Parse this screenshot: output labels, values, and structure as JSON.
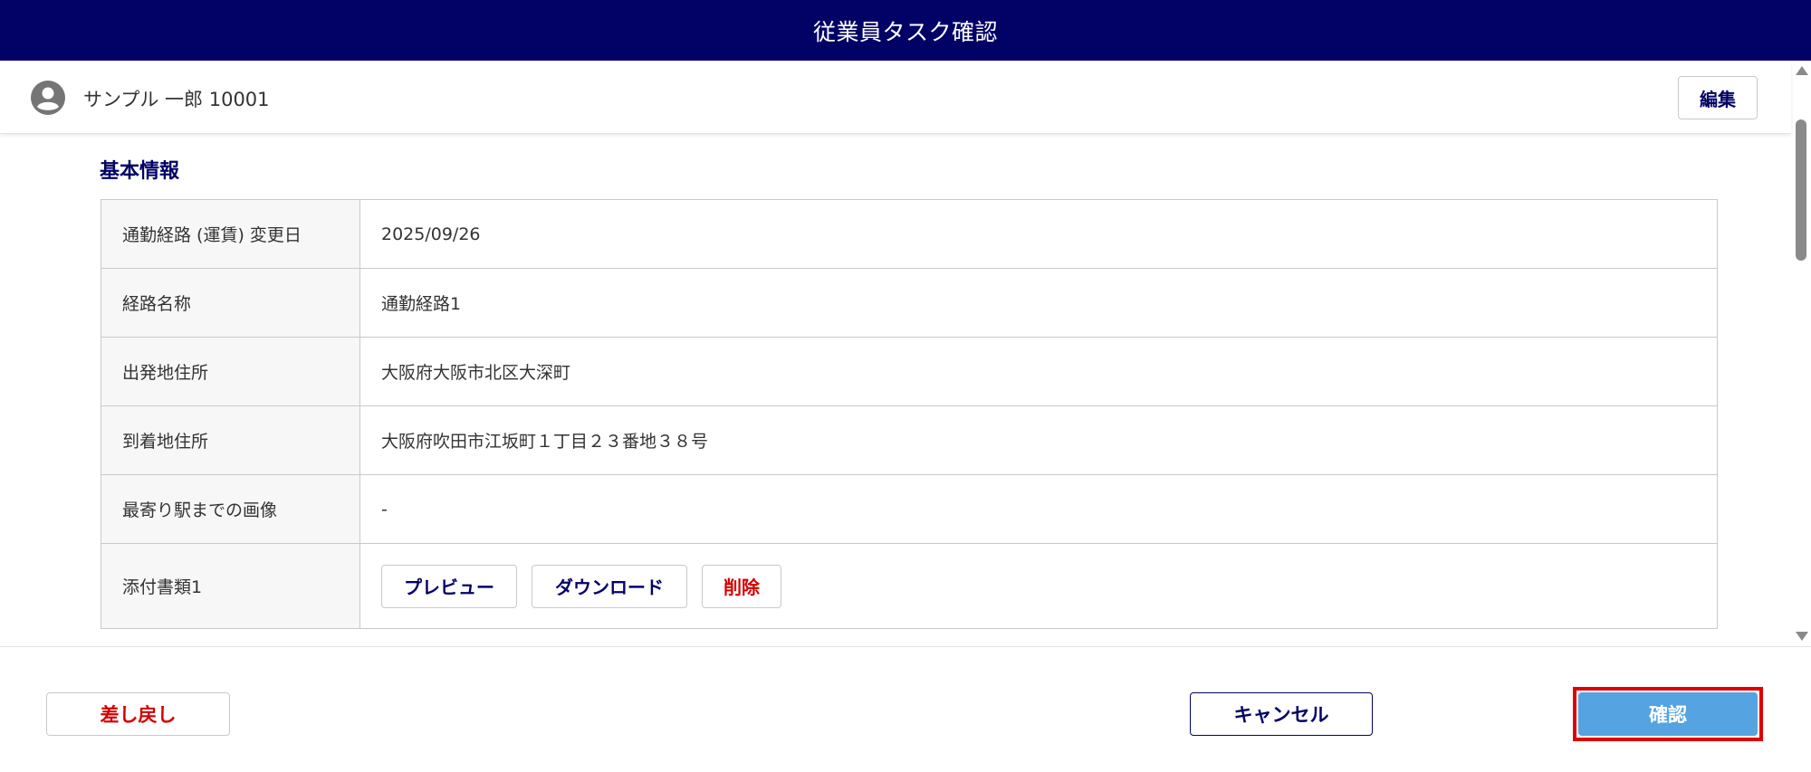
{
  "window": {
    "title": "従業員タスク確認"
  },
  "user": {
    "name": "サンプル 一郎 10001",
    "edit_label": "編集"
  },
  "section": {
    "title": "基本情報",
    "rows": [
      {
        "label": "通勤経路 (運賃) 変更日",
        "value": "2025/09/26"
      },
      {
        "label": "経路名称",
        "value": "通勤経路1"
      },
      {
        "label": "出発地住所",
        "value": "大阪府大阪市北区大深町"
      },
      {
        "label": "到着地住所",
        "value": "大阪府吹田市江坂町１丁目２３番地３８号"
      },
      {
        "label": "最寄り駅までの画像",
        "value": "-"
      }
    ],
    "attachment": {
      "label": "添付書類1",
      "preview_label": "プレビュー",
      "download_label": "ダウンロード",
      "delete_label": "削除"
    }
  },
  "footer": {
    "return_label": "差し戻し",
    "cancel_label": "キャンセル",
    "confirm_label": "確認"
  },
  "colors": {
    "header_bg": "#020266",
    "accent_text": "#020266",
    "danger_text": "#d60000",
    "confirm_bg": "#55a3e0",
    "highlight_border": "#e00000"
  },
  "icons": [
    "user-avatar-icon",
    "scroll-up-icon",
    "scroll-down-icon"
  ]
}
